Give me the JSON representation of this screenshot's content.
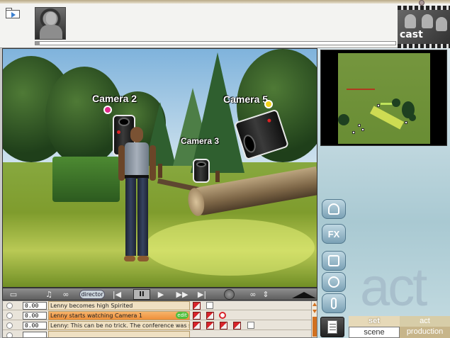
{
  "cast_panel": {
    "label": "cast"
  },
  "viewport": {
    "camera_labels": [
      "Camera 2",
      "Camera 5",
      "Camera 3"
    ]
  },
  "toolbar": {
    "director_label": "director",
    "pause_label": "II",
    "prev_label": "|◀",
    "play_label": "▶",
    "ffwd_label": "▶▶",
    "next_label": "▶|"
  },
  "timeline": {
    "rows": [
      {
        "time": "0.00",
        "text": "Lenny becomes high Spirited"
      },
      {
        "time": "0.00",
        "text": "Lenny starts watching Camera 1",
        "edit_label": "edit"
      },
      {
        "time": "0.00",
        "text": "Lenny: This can be no trick. The conference was sa..."
      }
    ]
  },
  "side_panel": {
    "fx_label": "FX",
    "brand_big": "act",
    "brand_small": "act"
  },
  "bottom_tabs": {
    "set_label": "set",
    "scene_label": "scene",
    "act_label": "act",
    "production_label": "production"
  },
  "colors": {
    "timeline_selected": "#ee8f3a",
    "edit_badge": "#4fbf3c",
    "flag_red": "#d8242b",
    "panel_blue": "#a9c9d2"
  },
  "icons": [
    "folder-open-icon",
    "avatar-icon",
    "cast-icon",
    "record-icon",
    "eject-icon",
    "character-group-icon",
    "camera-icon",
    "light-icon",
    "microphone-icon",
    "document-icon"
  ]
}
